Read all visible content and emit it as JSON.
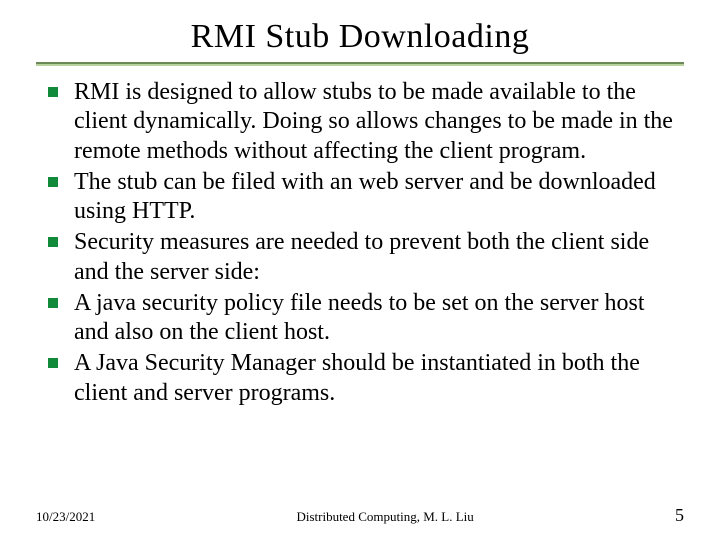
{
  "title": "RMI Stub Downloading",
  "bullets": [
    "RMI is designed to allow stubs to be made available to the client dynamically.  Doing so allows changes to be made in the remote methods without affecting the client program.",
    "The stub can be filed with an web server and be downloaded using HTTP.",
    "Security measures are needed to prevent both the client side and the server side:",
    "A java security policy file needs to be set on the server host and also on the client host.",
    "A Java Security Manager should be instantiated in both the client and server programs."
  ],
  "footer": {
    "date": "10/23/2021",
    "center": "Distributed Computing, M. L. Liu",
    "page": "5"
  }
}
